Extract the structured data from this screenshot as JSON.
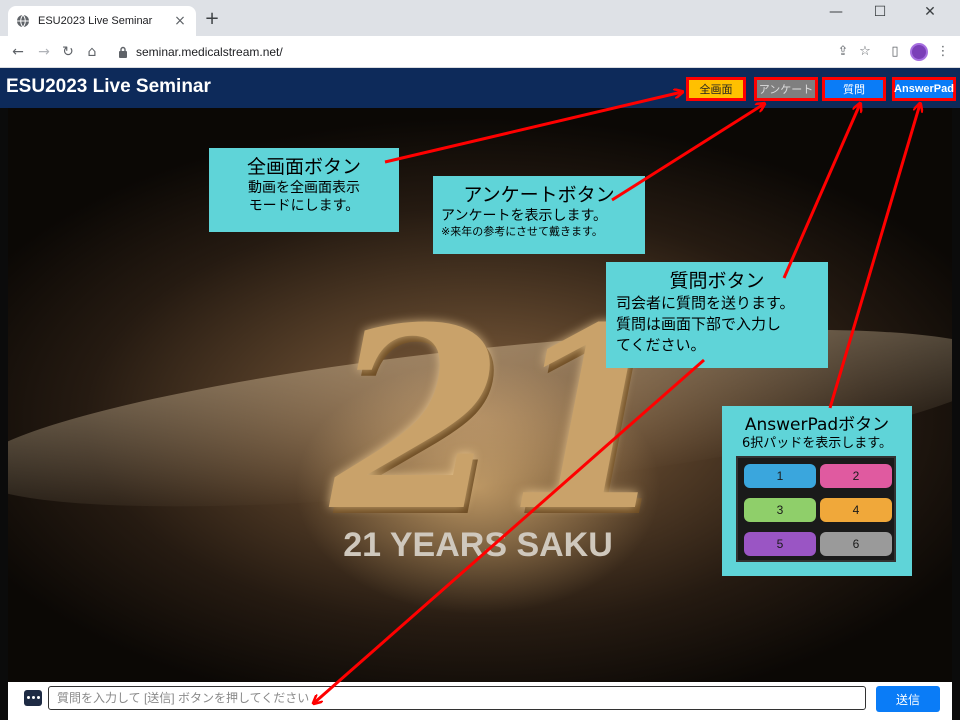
{
  "browser": {
    "tab_title": "ESU2023 Live Seminar",
    "tab_close": "×",
    "new_tab": "+",
    "url": "seminar.medicalstream.net/",
    "minimize": "—",
    "maximize": "☐",
    "close": "✕"
  },
  "header": {
    "title": "ESU2023 Live Seminar",
    "buttons": {
      "fullscreen": "全画面",
      "survey": "アンケート",
      "question": "質問",
      "answerpad": "AnswerPad"
    }
  },
  "video": {
    "caption": "21 YEARS SAKU",
    "numeral": "21"
  },
  "callouts": {
    "fullscreen": {
      "title": "全画面ボタン",
      "line1": "動画を全画面表示",
      "line2": "モードにします。"
    },
    "survey": {
      "title": "アンケートボタン",
      "line1": "アンケートを表示します。",
      "note": "※来年の参考にさせて戴きます。"
    },
    "question": {
      "title": "質問ボタン",
      "line1": "司会者に質問を送ります。",
      "line2": "質問は画面下部で入力し",
      "line3": "てください。"
    },
    "answerpad": {
      "title": "AnswerPadボタン",
      "line1": "6択パッドを表示します。"
    }
  },
  "answerpad": {
    "buttons": [
      "1",
      "2",
      "3",
      "4",
      "5",
      "6"
    ],
    "colors": [
      "#3aa6dd",
      "#e05aa0",
      "#8fcf6a",
      "#f0a83a",
      "#9a55c4",
      "#9a9a9a"
    ]
  },
  "input_bar": {
    "placeholder": "質問を入力して [送信] ボタンを押してください",
    "send_label": "送信"
  },
  "colors": {
    "header_bg": "#0d2a5a",
    "fullscreen_btn": "#ffc000",
    "survey_btn": "#7f7f7f",
    "question_btn": "#0a7cf7",
    "answerpad_btn": "#0a7cf7",
    "callout_bg": "#5fd4d8",
    "arrow": "#ff0000"
  }
}
